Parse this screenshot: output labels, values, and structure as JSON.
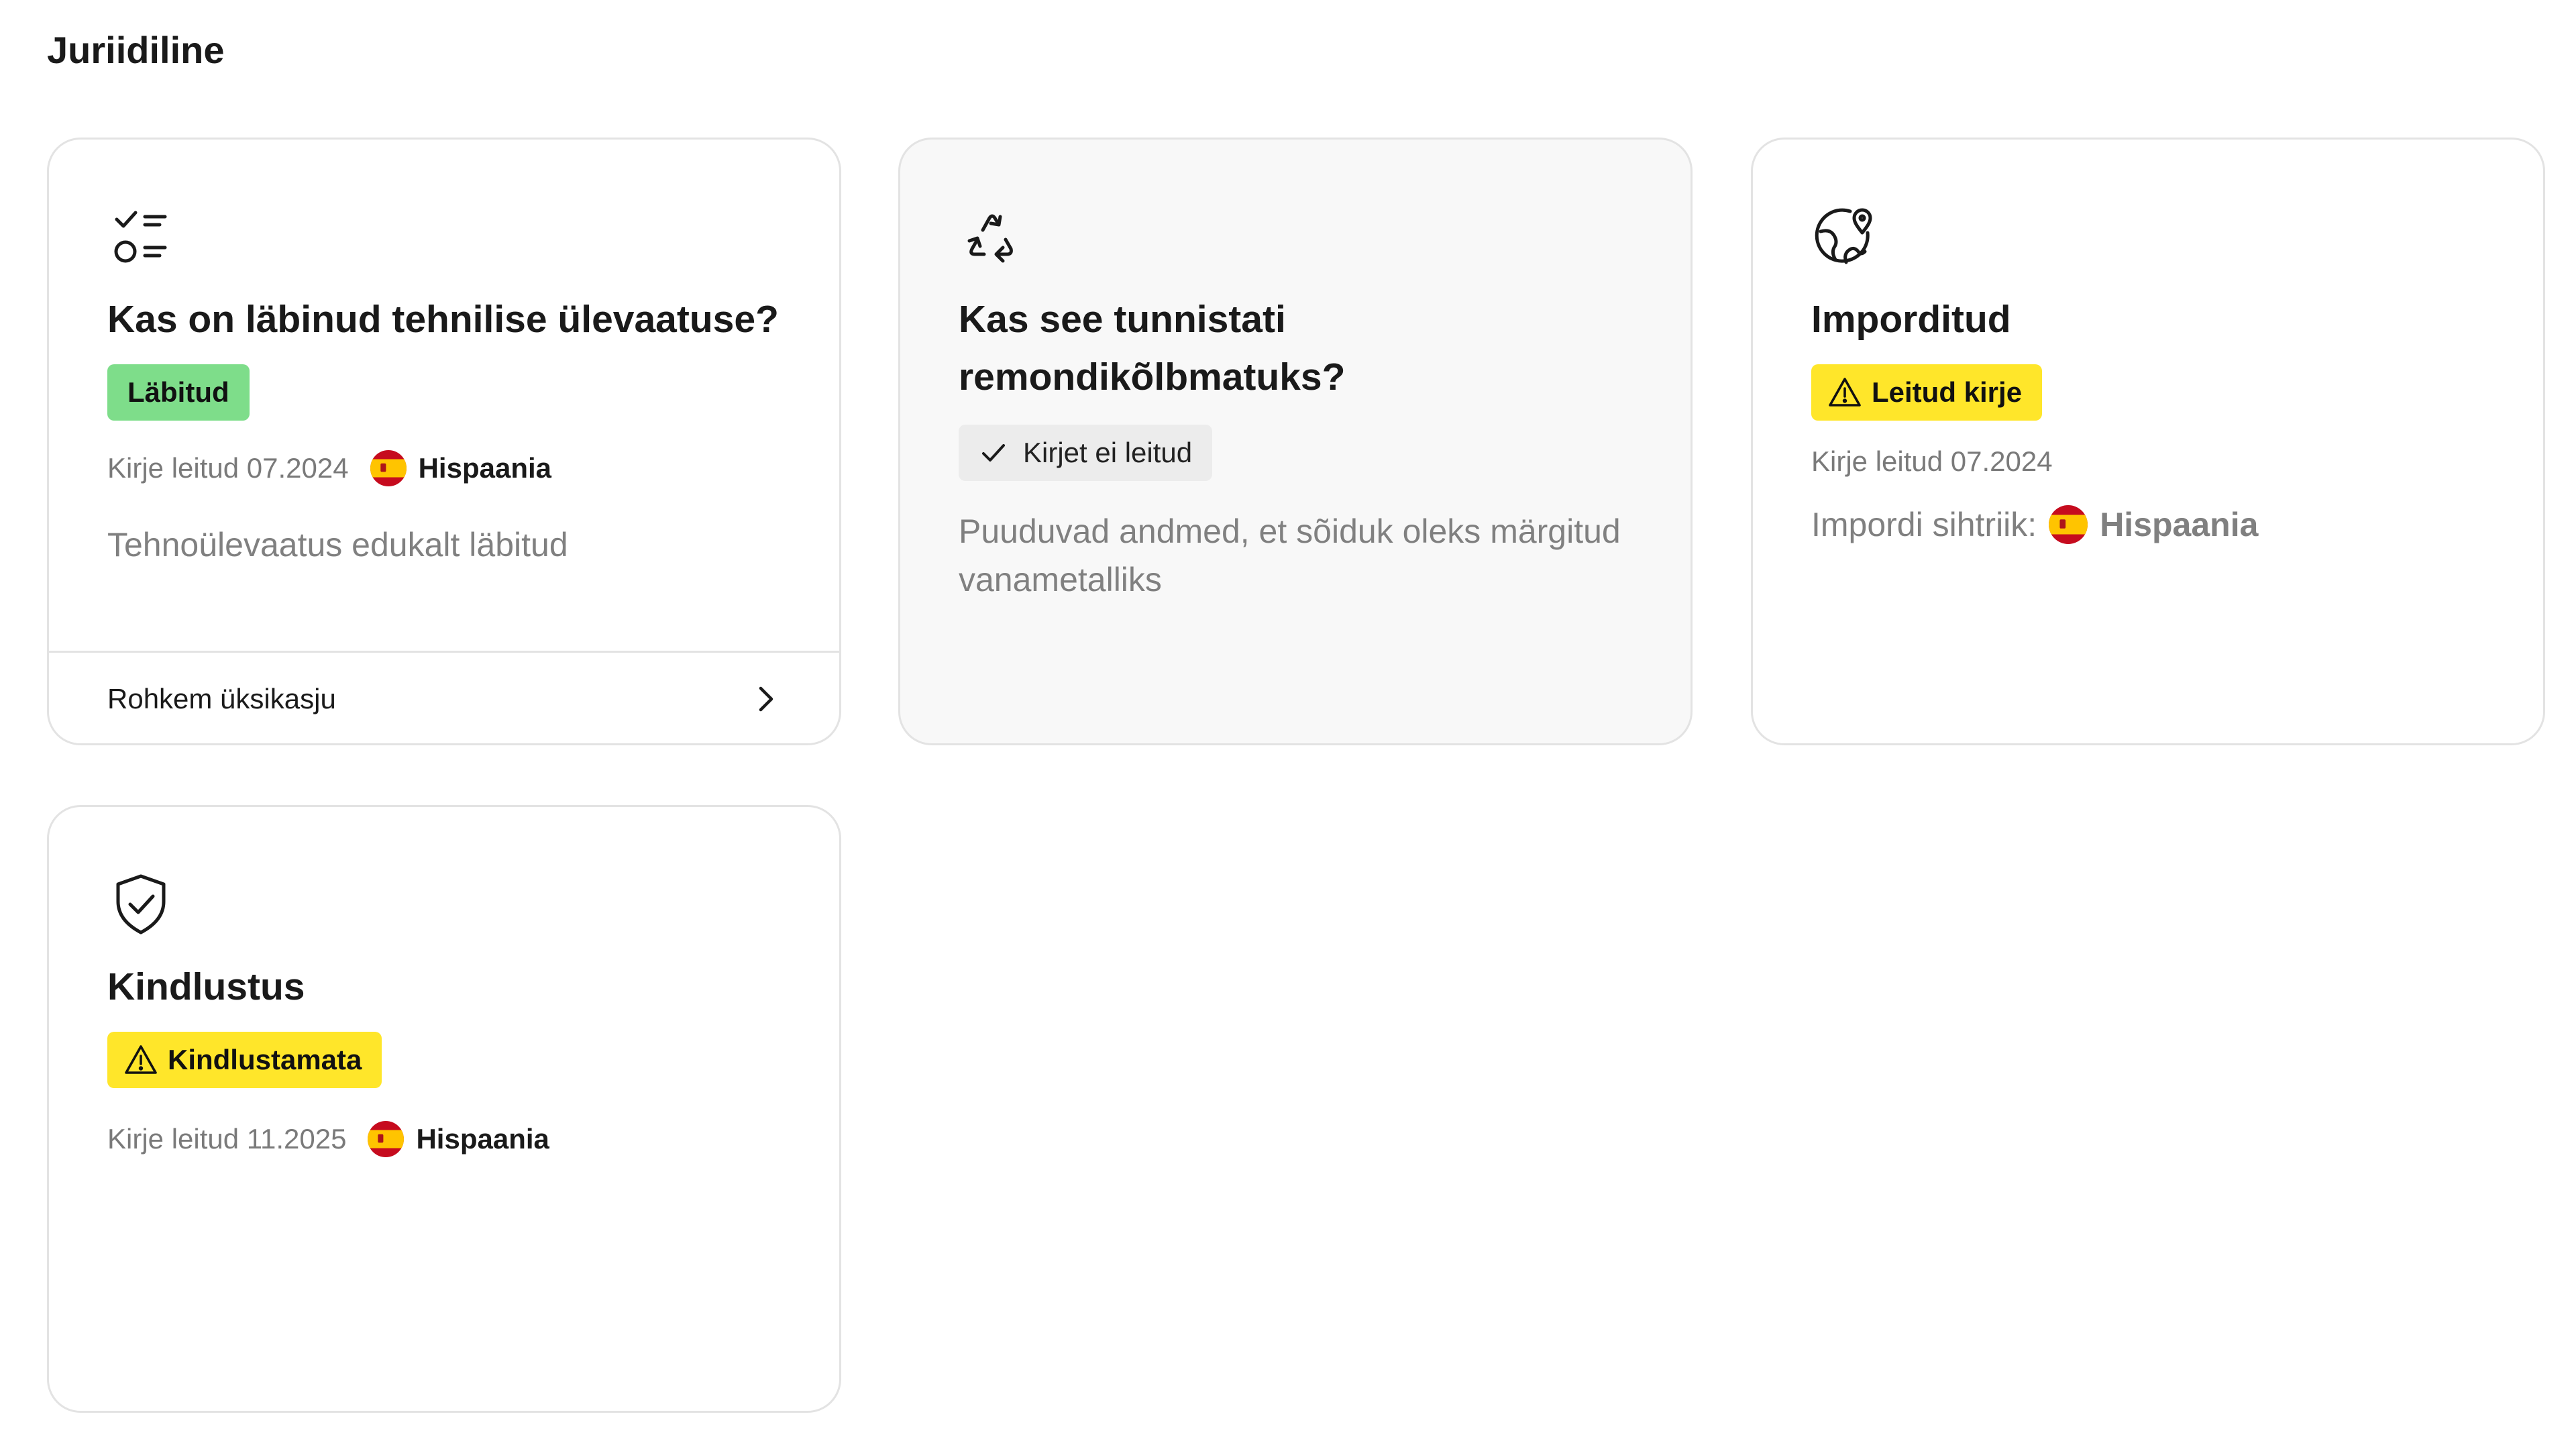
{
  "section": {
    "title": "Juriidiline"
  },
  "colors": {
    "pass_badge": "#7edd8a",
    "warning_badge": "#ffe62a",
    "neutral_badge": "#ececec",
    "card_border": "#e3e3e3",
    "muted_text": "#808080"
  },
  "cards": [
    {
      "icon": "checklist-icon",
      "title": "Kas on läbinud tehnilise ülevaatuse?",
      "badge": "Läbitud",
      "record_found": "Kirje leitud 07.2024",
      "country": "Hispaania",
      "country_flag": "spain-flag-icon",
      "description": "Tehnoülevaatus edukalt läbitud",
      "more_link": "Rohkem üksikasju",
      "more_icon": "chevron-right-icon"
    },
    {
      "icon": "recycle-icon",
      "title": "Kas see tunnistati remondikõlbmatuks?",
      "badge_icon": "check-icon",
      "badge": "Kirjet ei leitud",
      "description": "Puuduvad andmed, et sõiduk oleks märgitud vanametalliks"
    },
    {
      "icon": "globe-pin-icon",
      "title": "Imporditud",
      "badge_icon": "warning-icon",
      "badge": "Leitud kirje",
      "record_found": "Kirje leitud 07.2024",
      "import_label": "Impordi sihtriik:",
      "country": "Hispaania",
      "country_flag": "spain-flag-icon"
    },
    {
      "icon": "shield-check-icon",
      "title": "Kindlustus",
      "badge_icon": "warning-icon",
      "badge": "Kindlustamata",
      "record_found": "Kirje leitud 11.2025",
      "country": "Hispaania",
      "country_flag": "spain-flag-icon"
    }
  ]
}
